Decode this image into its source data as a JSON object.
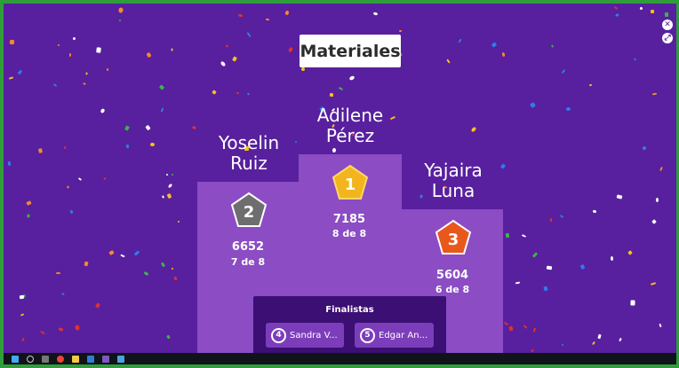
{
  "title": "Materiales",
  "colors": {
    "background": "#58209e",
    "pillar": "#8b4cc4",
    "first_badge": "#f2b51e",
    "second_badge": "#6e6e6e",
    "third_badge": "#e8581c",
    "finalists_panel": "#3b0f73"
  },
  "podium": [
    {
      "place_label": "1",
      "name_line1": "Adilene",
      "name_line2": "Pérez",
      "score": "7185",
      "correct": "8 de 8",
      "badge_icon": "gold-pentagon-badge-icon"
    },
    {
      "place_label": "2",
      "name_line1": "Yoselin",
      "name_line2": "Ruiz",
      "score": "6652",
      "correct": "7 de 8",
      "badge_icon": "silver-pentagon-badge-icon"
    },
    {
      "place_label": "3",
      "name_line1": "Yajaira",
      "name_line2": "Luna",
      "score": "5604",
      "correct": "6 de 8",
      "badge_icon": "bronze-pentagon-badge-icon"
    }
  ],
  "finalists": {
    "title": "Finalistas",
    "items": [
      {
        "num": "4",
        "name": "Sandra V..."
      },
      {
        "num": "5",
        "name": "Edgar An..."
      }
    ]
  },
  "corner_icons": [
    "close-icon",
    "expand-icon"
  ]
}
